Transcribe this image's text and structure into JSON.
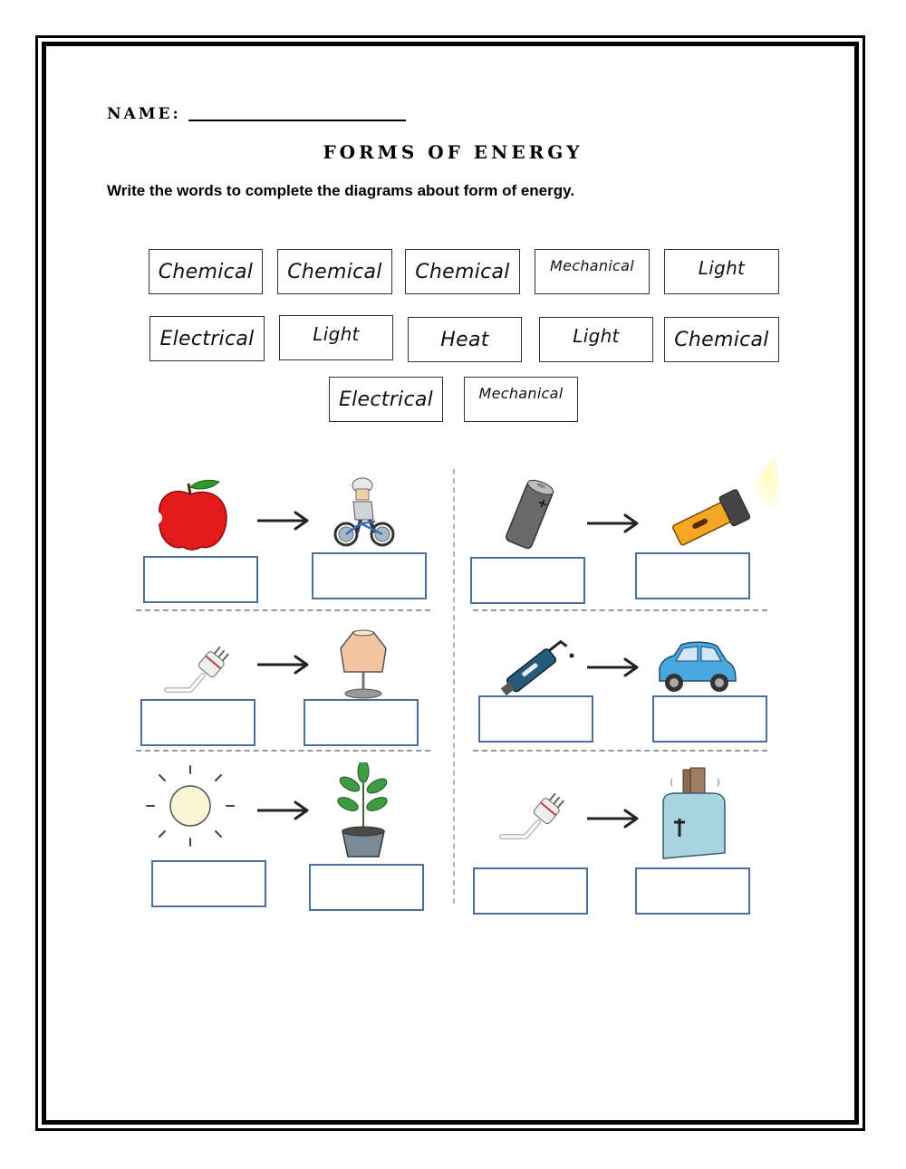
{
  "worksheet": {
    "name_label": "NAME:",
    "title": "Forms of Energy",
    "instruction": "Write the words to complete the diagrams about form of energy."
  },
  "word_bank": [
    "Chemical",
    "Chemical",
    "Chemical",
    "Mechanical",
    "Light",
    "Electrical",
    "Light",
    "Heat",
    "Light",
    "Chemical",
    "Electrical",
    "Mechanical"
  ],
  "diagrams": [
    {
      "source_icon": "apple-icon",
      "target_icon": "cyclist-icon",
      "source_answer": "",
      "target_answer": ""
    },
    {
      "source_icon": "battery-icon",
      "target_icon": "flashlight-icon",
      "source_answer": "",
      "target_answer": ""
    },
    {
      "source_icon": "plug-icon",
      "target_icon": "lamp-icon",
      "source_answer": "",
      "target_answer": ""
    },
    {
      "source_icon": "fuel-nozzle-icon",
      "target_icon": "car-icon",
      "source_answer": "",
      "target_answer": ""
    },
    {
      "source_icon": "sun-icon",
      "target_icon": "plant-icon",
      "source_answer": "",
      "target_answer": ""
    },
    {
      "source_icon": "plug-icon",
      "target_icon": "toaster-icon",
      "source_answer": "",
      "target_answer": ""
    }
  ],
  "colors": {
    "answer_box_border": "#4a70a0",
    "divider": "#9a9a9a",
    "apple": "#e31b1b",
    "flashlight": "#f5a623",
    "car": "#4aa8e0",
    "toaster": "#a9d3e0",
    "lamp_shade": "#f4c4a0"
  }
}
